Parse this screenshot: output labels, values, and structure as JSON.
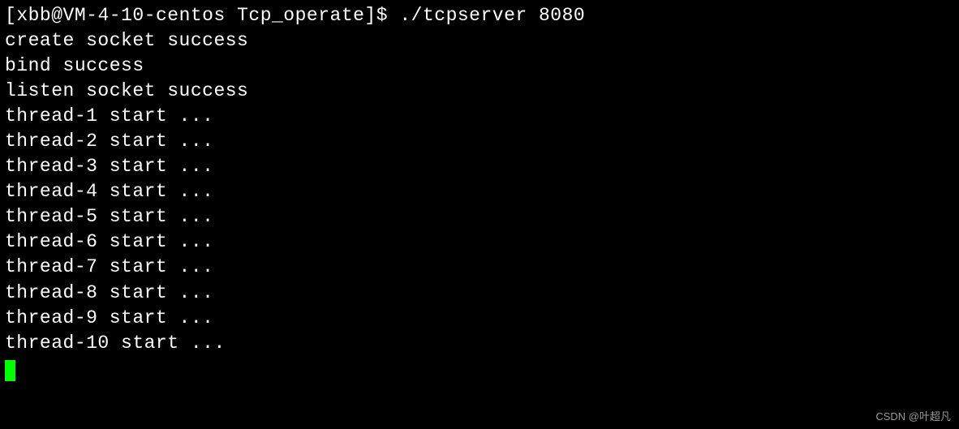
{
  "prompt": {
    "user": "xbb",
    "host": "VM-4-10-centos",
    "cwd": "Tcp_operate",
    "symbol": "$",
    "command": "./tcpserver 8080"
  },
  "output": {
    "lines": [
      "create socket success",
      "bind success",
      "listen socket success",
      "thread-1 start ...",
      "thread-2 start ...",
      "thread-3 start ...",
      "thread-4 start ...",
      "thread-5 start ...",
      "thread-6 start ...",
      "thread-7 start ...",
      "thread-8 start ...",
      "thread-9 start ...",
      "thread-10 start ..."
    ]
  },
  "watermark": "CSDN @叶超凡"
}
